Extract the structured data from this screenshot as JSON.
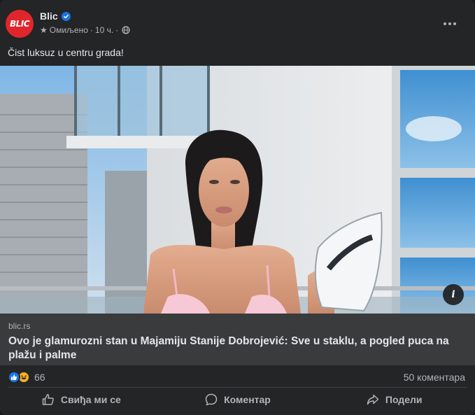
{
  "page": {
    "name": "Blic",
    "avatar_text": "BLIC",
    "meta_label": "Омиљено",
    "time": "10 ч.",
    "separator": "·"
  },
  "post": {
    "text": "Čist luksuz u centru grada!"
  },
  "link_preview": {
    "domain": "blic.rs",
    "title": "Ovo je glamurozni stan u Majamiju Stanije Dobrojević: Sve u staklu, a pogled puca na plažu i palme",
    "info_glyph": "i"
  },
  "stats": {
    "reaction_count": "66",
    "comments": "50 коментара",
    "reactions": [
      "like-icon",
      "haha-icon"
    ]
  },
  "actions": {
    "like": "Свиђа ми се",
    "comment": "Коментар",
    "share": "Подели"
  },
  "colors": {
    "card": "#242526",
    "link_box": "#3a3b3c",
    "accent": "#1877f2",
    "brand": "#e0262b"
  }
}
